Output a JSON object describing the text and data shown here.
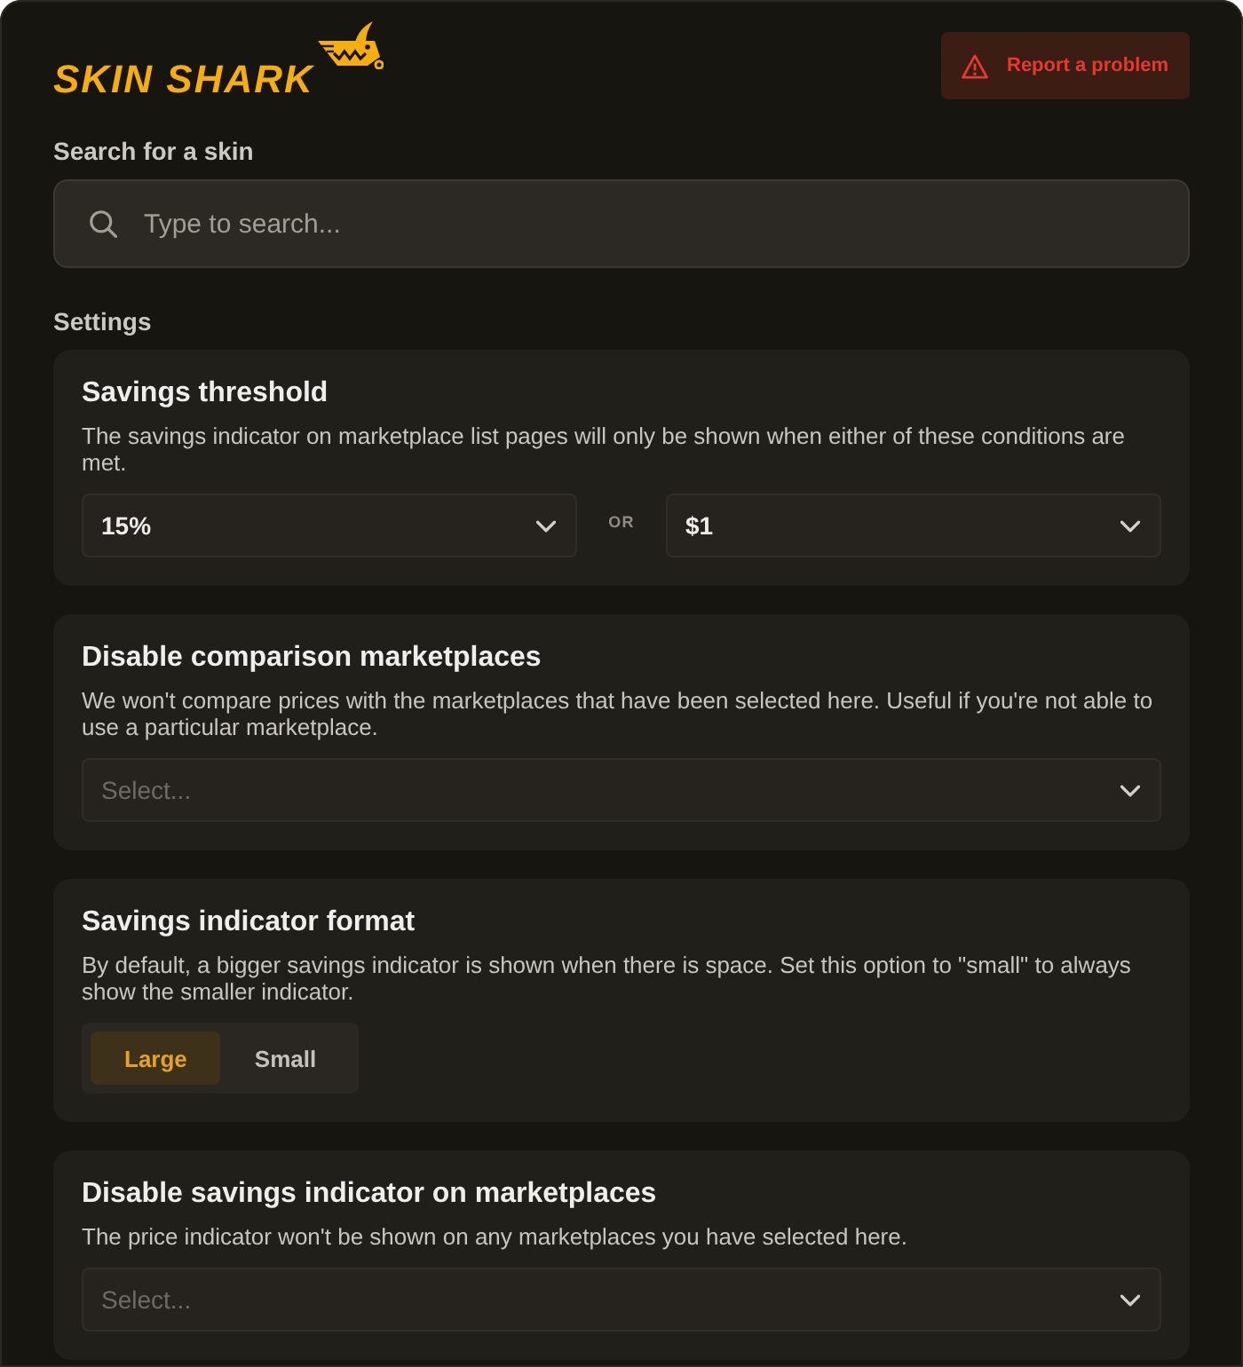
{
  "header": {
    "logo": "SKIN SHARK",
    "report_button": "Report a problem"
  },
  "search": {
    "label": "Search for a skin",
    "placeholder": "Type to search..."
  },
  "settings": {
    "heading": "Settings",
    "cards": [
      {
        "kind": "dual-select",
        "title": "Savings threshold",
        "description": "The savings indicator on marketplace list pages will only be shown when either of these conditions are met.",
        "selects": [
          {
            "value": "15%"
          },
          {
            "value": "$1"
          }
        ],
        "separator": "OR"
      },
      {
        "kind": "select",
        "title": "Disable comparison marketplaces",
        "description": "We won't compare prices with the marketplaces that have been selected here. Useful if you're not able to use a particular marketplace.",
        "select": {
          "placeholder": "Select..."
        }
      },
      {
        "kind": "segmented",
        "title": "Savings indicator format",
        "description": "By default, a bigger savings indicator is shown when there is space. Set this option to \"small\" to always show the smaller indicator.",
        "options": [
          {
            "label": "Large",
            "selected": true
          },
          {
            "label": "Small",
            "selected": false
          }
        ]
      },
      {
        "kind": "select",
        "title": "Disable savings indicator on marketplaces",
        "description": "The price indicator won't be shown on any marketplaces you have selected here.",
        "select": {
          "placeholder": "Select..."
        }
      }
    ]
  }
}
